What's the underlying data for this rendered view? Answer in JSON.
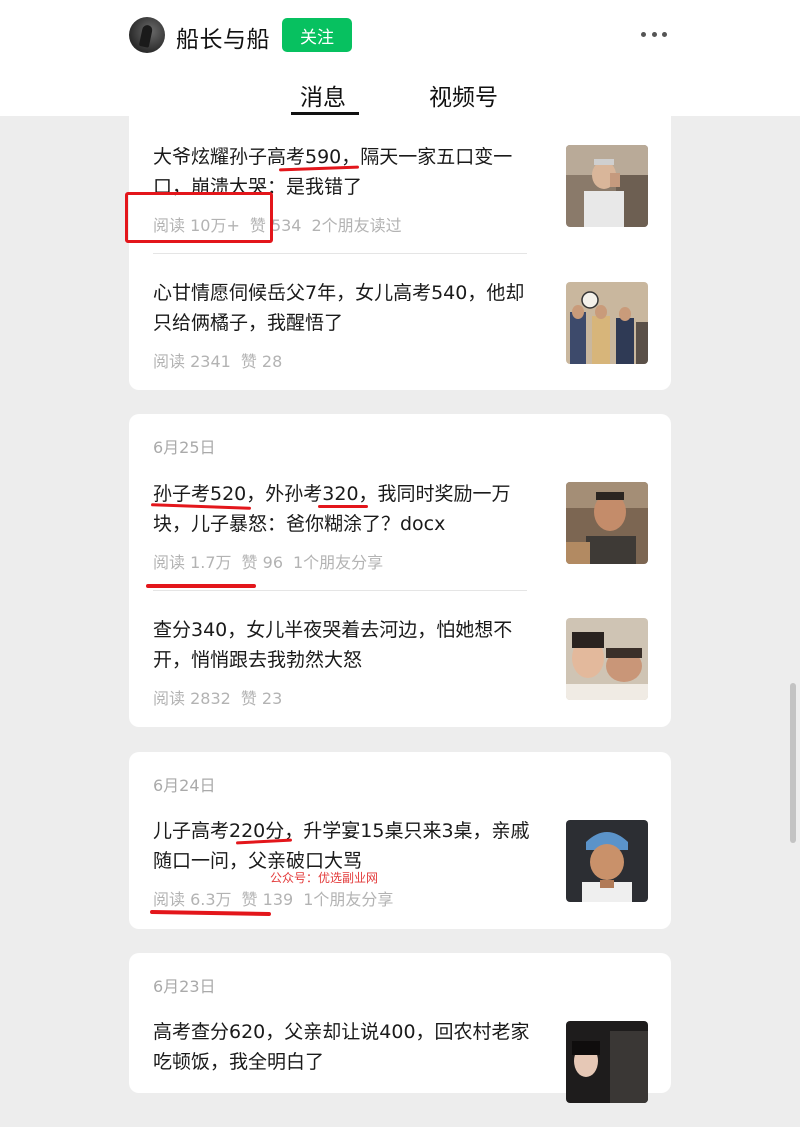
{
  "account": {
    "name": "船长与船",
    "follow_label": "关注"
  },
  "header": {
    "more_icon": "more-dots-icon"
  },
  "tabs": [
    {
      "label": "消息"
    },
    {
      "label": "视频号"
    }
  ],
  "colors": {
    "follow_green": "#07c160",
    "annotation_red": "#e3161b",
    "meta_gray": "#b3b3b3"
  },
  "cards": [
    {
      "articles": [
        {
          "title": "大爷炫耀孙子高考590，隔天一家五口变一口，崩溃大哭：是我错了",
          "reads": "阅读 10万+",
          "likes": "赞 534",
          "friends": "2个朋友读过"
        },
        {
          "title": "心甘情愿伺候岳父7年，女儿高考540，他却只给俩橘子，我醒悟了",
          "reads": "阅读 2341",
          "likes": "赞 28",
          "friends": ""
        }
      ]
    },
    {
      "date": "6月25日",
      "articles": [
        {
          "title": "孙子考520，外孙考320，我同时奖励一万块，儿子暴怒：爸你糊涂了？docx",
          "reads": "阅读 1.7万",
          "likes": "赞 96",
          "friends": "1个朋友分享"
        },
        {
          "title": "查分340，女儿半夜哭着去河边，怕她想不开，悄悄跟去我勃然大怒",
          "reads": "阅读 2832",
          "likes": "赞 23",
          "friends": ""
        }
      ]
    },
    {
      "date": "6月24日",
      "articles": [
        {
          "title": "儿子高考220分，升学宴15桌只来3桌，亲戚随口一问，父亲破口大骂",
          "reads": "阅读 6.3万",
          "likes": "赞 139",
          "friends": "1个朋友分享"
        }
      ]
    },
    {
      "date": "6月23日",
      "articles": [
        {
          "title": "高考查分620，父亲却让说400，回农村老家吃顿饭，我全明白了",
          "reads": "",
          "likes": "",
          "friends": ""
        }
      ]
    }
  ],
  "watermark": "公众号：优选副业网"
}
